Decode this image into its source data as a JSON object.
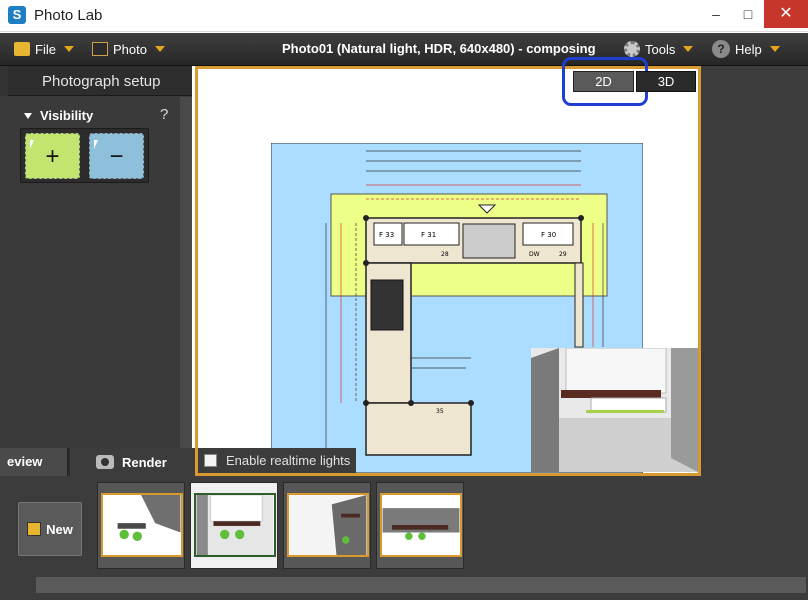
{
  "app": {
    "title": "Photo Lab",
    "icon": "app-logo-icon"
  },
  "window": {
    "minimize": "–",
    "maximize": "□",
    "close": "✕"
  },
  "menu": {
    "file": "File",
    "photo": "Photo",
    "tools": "Tools",
    "help": "Help",
    "document_title": "Photo01 (Natural light, HDR, 640x480)",
    "document_status": "- composing"
  },
  "left_panel": {
    "title": "Photograph setup",
    "visibility_label": "Visibility",
    "help_symbol": "?",
    "plus": "+",
    "minus": "−",
    "tabs": {
      "preview": "eview",
      "render": "Render"
    }
  },
  "canvas": {
    "view_2d": "2D",
    "view_3d": "3D",
    "realtime_label": "Enable realtime lights",
    "plan_labels": [
      "F 33",
      "F 31",
      "F 30",
      "28",
      "29",
      "DW",
      "35"
    ],
    "colors": {
      "wall_fill": "#eee6d1",
      "yellow_zone": "#eeff88",
      "blue_zone": "#aaddff",
      "accent": "#d89a2e"
    }
  },
  "bottom": {
    "new_label": "New",
    "thumbnails": [
      "photo-1",
      "photo-2",
      "photo-3",
      "photo-4"
    ]
  }
}
